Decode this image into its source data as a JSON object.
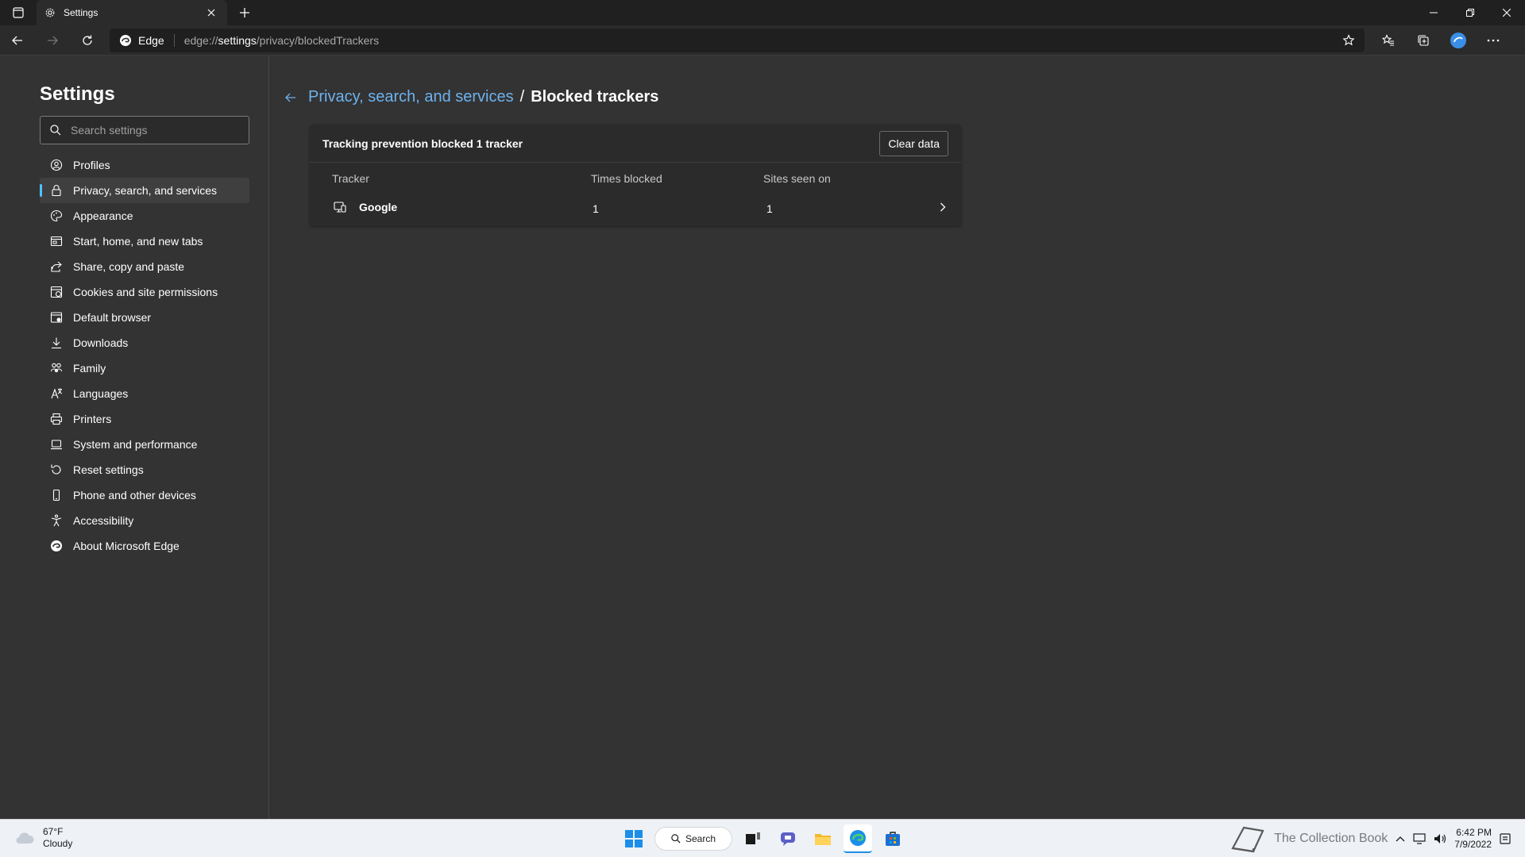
{
  "browser": {
    "tab_title": "Settings",
    "site_chip": "Edge",
    "url_prefix": "edge://",
    "url_host": "settings",
    "url_path": "/privacy/blockedTrackers"
  },
  "sidebar": {
    "title": "Settings",
    "search_placeholder": "Search settings",
    "items": [
      {
        "label": "Profiles",
        "icon": "profile-icon"
      },
      {
        "label": "Privacy, search, and services",
        "icon": "lock-icon",
        "active": true
      },
      {
        "label": "Appearance",
        "icon": "palette-icon"
      },
      {
        "label": "Start, home, and new tabs",
        "icon": "home-tabs-icon"
      },
      {
        "label": "Share, copy and paste",
        "icon": "share-icon"
      },
      {
        "label": "Cookies and site permissions",
        "icon": "cookies-icon"
      },
      {
        "label": "Default browser",
        "icon": "browser-icon"
      },
      {
        "label": "Downloads",
        "icon": "download-icon"
      },
      {
        "label": "Family",
        "icon": "family-icon"
      },
      {
        "label": "Languages",
        "icon": "language-icon"
      },
      {
        "label": "Printers",
        "icon": "printer-icon"
      },
      {
        "label": "System and performance",
        "icon": "laptop-icon"
      },
      {
        "label": "Reset settings",
        "icon": "reset-icon"
      },
      {
        "label": "Phone and other devices",
        "icon": "phone-icon"
      },
      {
        "label": "Accessibility",
        "icon": "accessibility-icon"
      },
      {
        "label": "About Microsoft Edge",
        "icon": "edge-icon"
      }
    ]
  },
  "main": {
    "breadcrumb_parent": "Privacy, search, and services",
    "breadcrumb_sep": "/",
    "breadcrumb_current": "Blocked trackers",
    "summary": "Tracking prevention blocked 1 tracker",
    "clear_button": "Clear data",
    "columns": [
      "Tracker",
      "Times blocked",
      "Sites seen on"
    ],
    "rows": [
      {
        "tracker": "Google",
        "times_blocked": "1",
        "sites_seen_on": "1"
      }
    ]
  },
  "taskbar": {
    "temperature": "67°F",
    "condition": "Cloudy",
    "search_label": "Search",
    "watermark": "The Collection Book",
    "time": "6:42 PM",
    "date": "7/9/2022"
  },
  "colors": {
    "accent": "#4cc2ff",
    "link": "#6db2ee",
    "page_bg": "#333333"
  }
}
